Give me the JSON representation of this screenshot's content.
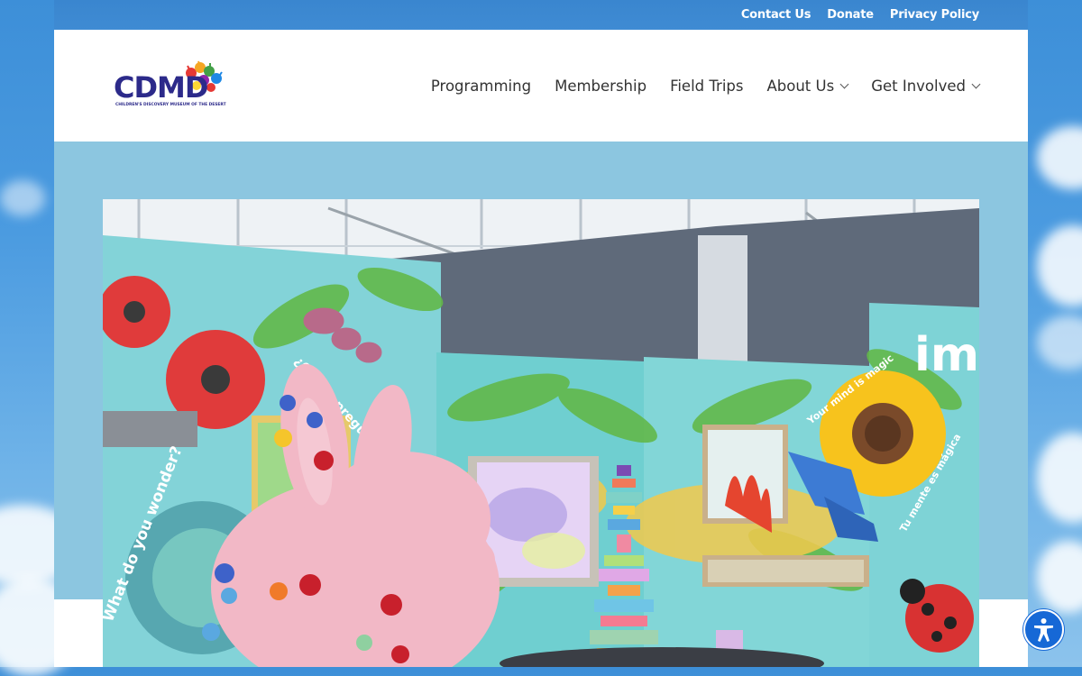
{
  "topbar": {
    "links": [
      "Contact Us",
      "Donate",
      "Privacy Policy"
    ]
  },
  "header": {
    "logo": {
      "text": "CDMD",
      "subtitle": "CHILDREN'S DISCOVERY MUSEUM OF THE DESERT"
    },
    "nav": [
      {
        "label": "Programming",
        "has_dropdown": false
      },
      {
        "label": "Membership",
        "has_dropdown": false
      },
      {
        "label": "Field Trips",
        "has_dropdown": false
      },
      {
        "label": "About Us",
        "has_dropdown": true
      },
      {
        "label": "Get Involved",
        "has_dropdown": true
      }
    ]
  },
  "hero": {
    "murals": [
      "What do you wonder?",
      "¿Que te pregunta?",
      "Your mind is magic",
      "Tu mente es mágica",
      "im"
    ]
  },
  "accessibility_button": {
    "icon": "accessibility-icon",
    "color": "#1668d6"
  },
  "colors": {
    "topbar": "#3a86cf",
    "band": "#8cc6e0",
    "brand": "#2c2a8a"
  }
}
